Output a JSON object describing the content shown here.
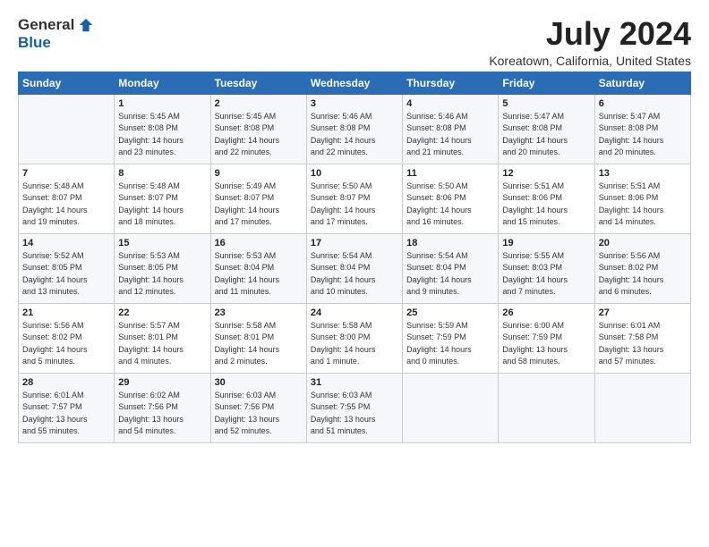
{
  "header": {
    "logo_general": "General",
    "logo_blue": "Blue",
    "month_year": "July 2024",
    "location": "Koreatown, California, United States"
  },
  "weekdays": [
    "Sunday",
    "Monday",
    "Tuesday",
    "Wednesday",
    "Thursday",
    "Friday",
    "Saturday"
  ],
  "weeks": [
    [
      {
        "day": "",
        "info": ""
      },
      {
        "day": "1",
        "info": "Sunrise: 5:45 AM\nSunset: 8:08 PM\nDaylight: 14 hours\nand 23 minutes."
      },
      {
        "day": "2",
        "info": "Sunrise: 5:45 AM\nSunset: 8:08 PM\nDaylight: 14 hours\nand 22 minutes."
      },
      {
        "day": "3",
        "info": "Sunrise: 5:46 AM\nSunset: 8:08 PM\nDaylight: 14 hours\nand 22 minutes."
      },
      {
        "day": "4",
        "info": "Sunrise: 5:46 AM\nSunset: 8:08 PM\nDaylight: 14 hours\nand 21 minutes."
      },
      {
        "day": "5",
        "info": "Sunrise: 5:47 AM\nSunset: 8:08 PM\nDaylight: 14 hours\nand 20 minutes."
      },
      {
        "day": "6",
        "info": "Sunrise: 5:47 AM\nSunset: 8:08 PM\nDaylight: 14 hours\nand 20 minutes."
      }
    ],
    [
      {
        "day": "7",
        "info": "Sunrise: 5:48 AM\nSunset: 8:07 PM\nDaylight: 14 hours\nand 19 minutes."
      },
      {
        "day": "8",
        "info": "Sunrise: 5:48 AM\nSunset: 8:07 PM\nDaylight: 14 hours\nand 18 minutes."
      },
      {
        "day": "9",
        "info": "Sunrise: 5:49 AM\nSunset: 8:07 PM\nDaylight: 14 hours\nand 17 minutes."
      },
      {
        "day": "10",
        "info": "Sunrise: 5:50 AM\nSunset: 8:07 PM\nDaylight: 14 hours\nand 17 minutes."
      },
      {
        "day": "11",
        "info": "Sunrise: 5:50 AM\nSunset: 8:06 PM\nDaylight: 14 hours\nand 16 minutes."
      },
      {
        "day": "12",
        "info": "Sunrise: 5:51 AM\nSunset: 8:06 PM\nDaylight: 14 hours\nand 15 minutes."
      },
      {
        "day": "13",
        "info": "Sunrise: 5:51 AM\nSunset: 8:06 PM\nDaylight: 14 hours\nand 14 minutes."
      }
    ],
    [
      {
        "day": "14",
        "info": "Sunrise: 5:52 AM\nSunset: 8:05 PM\nDaylight: 14 hours\nand 13 minutes."
      },
      {
        "day": "15",
        "info": "Sunrise: 5:53 AM\nSunset: 8:05 PM\nDaylight: 14 hours\nand 12 minutes."
      },
      {
        "day": "16",
        "info": "Sunrise: 5:53 AM\nSunset: 8:04 PM\nDaylight: 14 hours\nand 11 minutes."
      },
      {
        "day": "17",
        "info": "Sunrise: 5:54 AM\nSunset: 8:04 PM\nDaylight: 14 hours\nand 10 minutes."
      },
      {
        "day": "18",
        "info": "Sunrise: 5:54 AM\nSunset: 8:04 PM\nDaylight: 14 hours\nand 9 minutes."
      },
      {
        "day": "19",
        "info": "Sunrise: 5:55 AM\nSunset: 8:03 PM\nDaylight: 14 hours\nand 7 minutes."
      },
      {
        "day": "20",
        "info": "Sunrise: 5:56 AM\nSunset: 8:02 PM\nDaylight: 14 hours\nand 6 minutes."
      }
    ],
    [
      {
        "day": "21",
        "info": "Sunrise: 5:56 AM\nSunset: 8:02 PM\nDaylight: 14 hours\nand 5 minutes."
      },
      {
        "day": "22",
        "info": "Sunrise: 5:57 AM\nSunset: 8:01 PM\nDaylight: 14 hours\nand 4 minutes."
      },
      {
        "day": "23",
        "info": "Sunrise: 5:58 AM\nSunset: 8:01 PM\nDaylight: 14 hours\nand 2 minutes."
      },
      {
        "day": "24",
        "info": "Sunrise: 5:58 AM\nSunset: 8:00 PM\nDaylight: 14 hours\nand 1 minute."
      },
      {
        "day": "25",
        "info": "Sunrise: 5:59 AM\nSunset: 7:59 PM\nDaylight: 14 hours\nand 0 minutes."
      },
      {
        "day": "26",
        "info": "Sunrise: 6:00 AM\nSunset: 7:59 PM\nDaylight: 13 hours\nand 58 minutes."
      },
      {
        "day": "27",
        "info": "Sunrise: 6:01 AM\nSunset: 7:58 PM\nDaylight: 13 hours\nand 57 minutes."
      }
    ],
    [
      {
        "day": "28",
        "info": "Sunrise: 6:01 AM\nSunset: 7:57 PM\nDaylight: 13 hours\nand 55 minutes."
      },
      {
        "day": "29",
        "info": "Sunrise: 6:02 AM\nSunset: 7:56 PM\nDaylight: 13 hours\nand 54 minutes."
      },
      {
        "day": "30",
        "info": "Sunrise: 6:03 AM\nSunset: 7:56 PM\nDaylight: 13 hours\nand 52 minutes."
      },
      {
        "day": "31",
        "info": "Sunrise: 6:03 AM\nSunset: 7:55 PM\nDaylight: 13 hours\nand 51 minutes."
      },
      {
        "day": "",
        "info": ""
      },
      {
        "day": "",
        "info": ""
      },
      {
        "day": "",
        "info": ""
      }
    ]
  ]
}
